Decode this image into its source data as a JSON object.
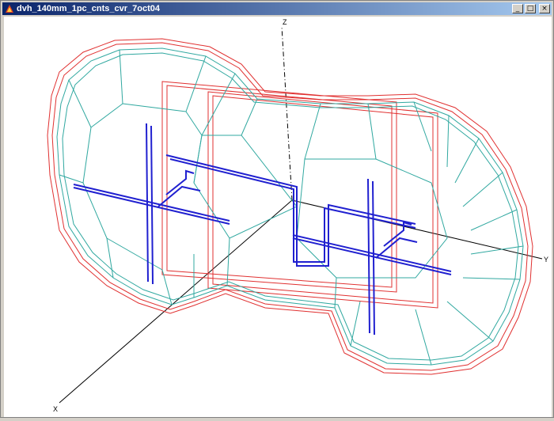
{
  "window": {
    "title": "dvh_140mm_1pc_cnts_cvr_7oct04",
    "minimize_label": "_",
    "maximize_label": "□",
    "close_label": "×"
  },
  "viewport": {
    "axis_z_label": "Z",
    "axis_y_label": "Y",
    "axis_x_label": "X"
  },
  "colors": {
    "outer_shell": "#e03030",
    "inner_shell": "#30a8a0",
    "conductor": "#2020d0",
    "axis": "#000000"
  }
}
